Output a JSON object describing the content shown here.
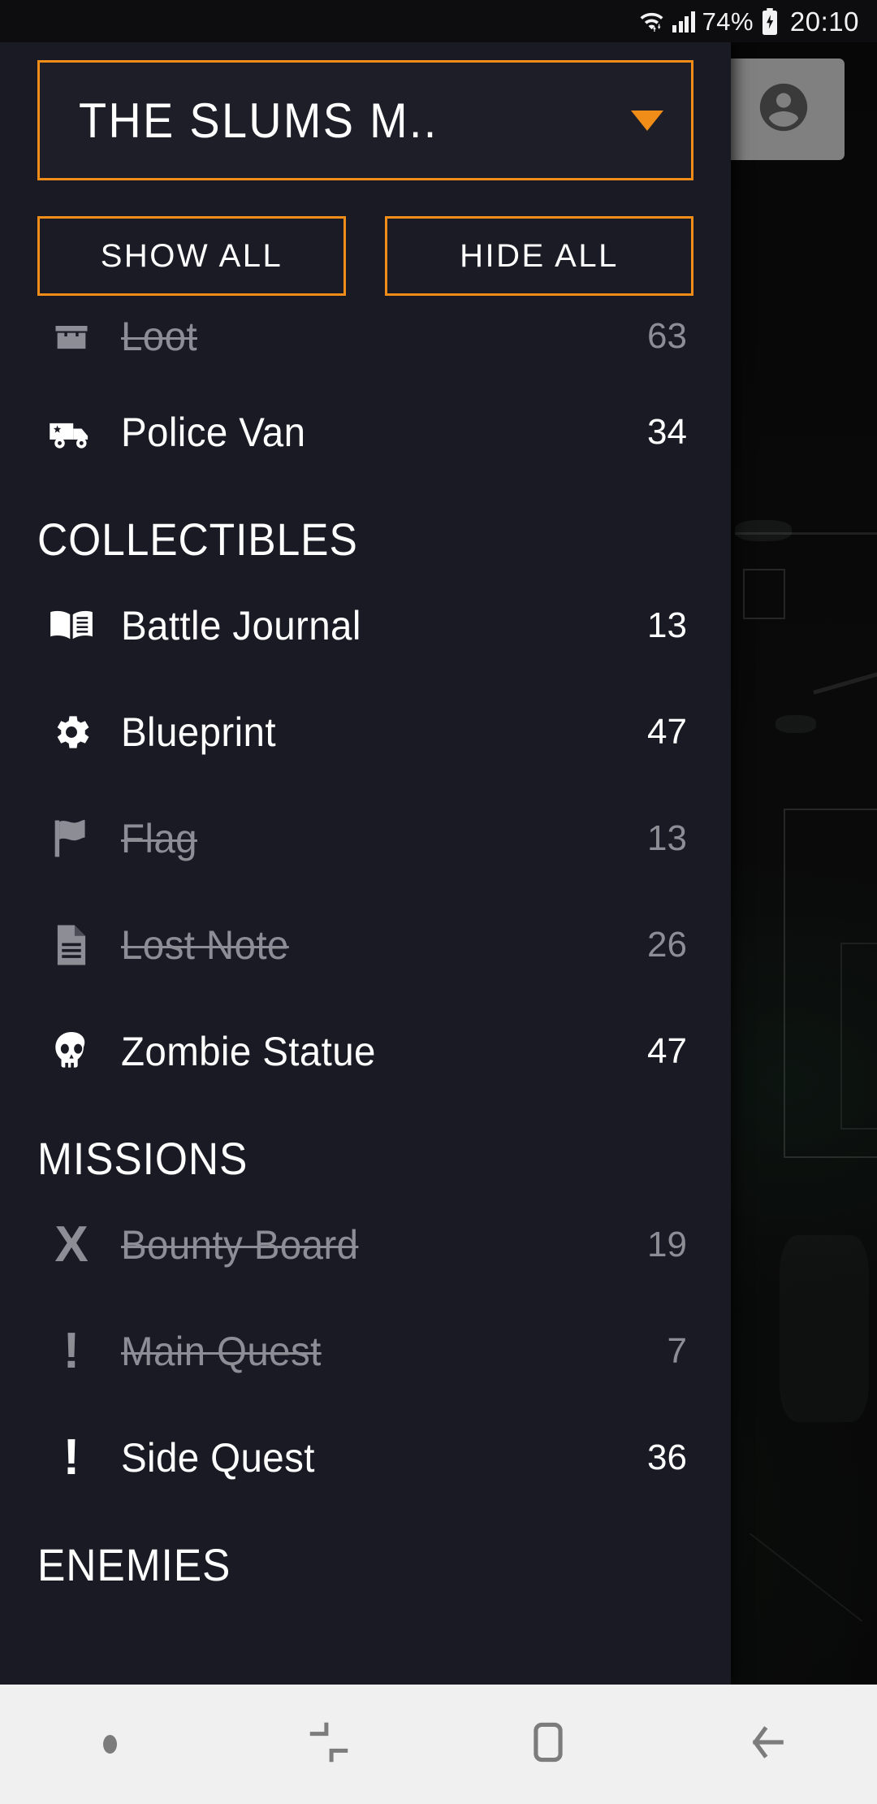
{
  "status_bar": {
    "wifi_icon": "wifi-icon",
    "signal_icon": "cellular-signal-icon",
    "battery_text": "74%",
    "battery_icon": "battery-charging-icon",
    "clock": "20:10"
  },
  "account_card": {
    "icon": "account-circle-icon"
  },
  "panel": {
    "region_selector": {
      "value": "THE SLUMS M..",
      "caret_icon": "caret-down-icon",
      "accent_color": "#f08c18"
    },
    "buttons": {
      "show_all": "SHOW ALL",
      "hide_all": "HIDE ALL"
    },
    "sections": [
      {
        "title": "",
        "items": [
          {
            "icon": "loot-crate-icon",
            "label": "Loot",
            "count": "63",
            "enabled": false
          },
          {
            "icon": "police-van-icon",
            "label": "Police Van",
            "count": "34",
            "enabled": true
          }
        ]
      },
      {
        "title": "COLLECTIBLES",
        "items": [
          {
            "icon": "open-book-icon",
            "label": "Battle Journal",
            "count": "13",
            "enabled": true
          },
          {
            "icon": "gear-icon",
            "label": "Blueprint",
            "count": "47",
            "enabled": true
          },
          {
            "icon": "flag-icon",
            "label": "Flag",
            "count": "13",
            "enabled": false
          },
          {
            "icon": "document-icon",
            "label": "Lost Note",
            "count": "26",
            "enabled": false
          },
          {
            "icon": "skull-icon",
            "label": "Zombie Statue",
            "count": "47",
            "enabled": true
          }
        ]
      },
      {
        "title": "MISSIONS",
        "items": [
          {
            "icon": "x-mark-icon",
            "label": "Bounty Board",
            "count": "19",
            "enabled": false
          },
          {
            "icon": "exclamation-icon",
            "label": "Main Quest",
            "count": "7",
            "enabled": false
          },
          {
            "icon": "exclamation-icon",
            "label": "Side Quest",
            "count": "36",
            "enabled": true
          }
        ]
      },
      {
        "title": "ENEMIES",
        "items": []
      }
    ]
  },
  "navbar": {
    "items": [
      {
        "icon": "nav-dot-icon"
      },
      {
        "icon": "recents-icon"
      },
      {
        "icon": "home-icon"
      },
      {
        "icon": "back-icon"
      }
    ]
  },
  "colors": {
    "accent": "#f08c18",
    "panel_bg": "#1a1a24",
    "disabled_text": "#8d8d95",
    "active_text": "#ffffff",
    "navbar_bg": "#f0f0f0"
  }
}
